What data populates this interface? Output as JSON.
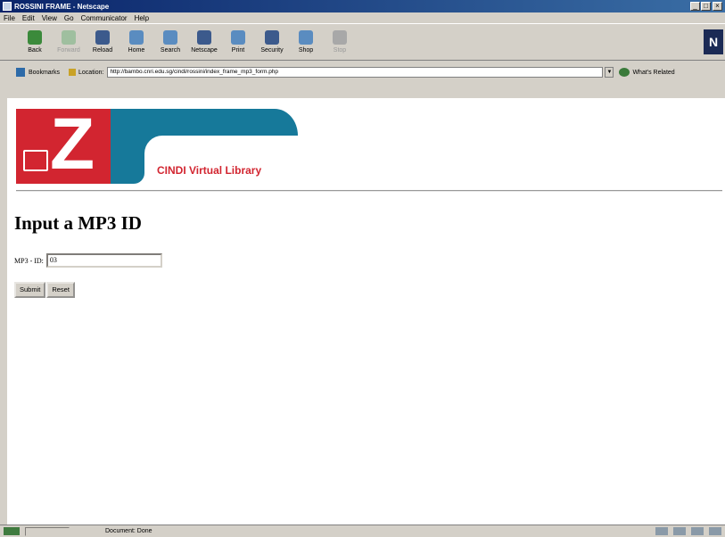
{
  "window": {
    "title": "ROSSINI FRAME - Netscape",
    "controls": [
      "_",
      "□",
      "×"
    ]
  },
  "menu": [
    "File",
    "Edit",
    "View",
    "Go",
    "Communicator",
    "Help"
  ],
  "toolbar": [
    {
      "label": "Back",
      "icon": "back-arrow-icon",
      "color": "#3b8a3b",
      "enabled": true
    },
    {
      "label": "Forward",
      "icon": "forward-arrow-icon",
      "color": "#9fbf9f",
      "enabled": false
    },
    {
      "label": "Reload",
      "icon": "reload-icon",
      "color": "#3c5a8c",
      "enabled": true
    },
    {
      "label": "Home",
      "icon": "home-icon",
      "color": "#5a8cc0",
      "enabled": true
    },
    {
      "label": "Search",
      "icon": "search-icon",
      "color": "#5a8cc0",
      "enabled": true
    },
    {
      "label": "Netscape",
      "icon": "netscape-icon",
      "color": "#3c5a8c",
      "enabled": true
    },
    {
      "label": "Print",
      "icon": "print-icon",
      "color": "#5a8cc0",
      "enabled": true
    },
    {
      "label": "Security",
      "icon": "security-icon",
      "color": "#3c5a8c",
      "enabled": true
    },
    {
      "label": "Shop",
      "icon": "shop-icon",
      "color": "#5a8cc0",
      "enabled": true
    },
    {
      "label": "Stop",
      "icon": "stop-icon",
      "color": "#a8a8a8",
      "enabled": false
    }
  ],
  "location_bar": {
    "bookmarks_label": "Bookmarks",
    "location_label": "Location:",
    "url": "http://bambo.cnri.edu.sg/cindi/rossini/index_frame_mp3_form.php",
    "related_label": "What's Related"
  },
  "banner": {
    "logo_letter": "Z",
    "library_name": "CINDI Virtual Library",
    "colors": {
      "red": "#d22530",
      "teal": "#16799a"
    }
  },
  "page": {
    "heading": "Input a MP3 ID",
    "field_label": "MP3 - ID:",
    "field_value": "03",
    "submit_label": "Submit",
    "reset_label": "Reset"
  },
  "status": {
    "text": "Document: Done"
  }
}
